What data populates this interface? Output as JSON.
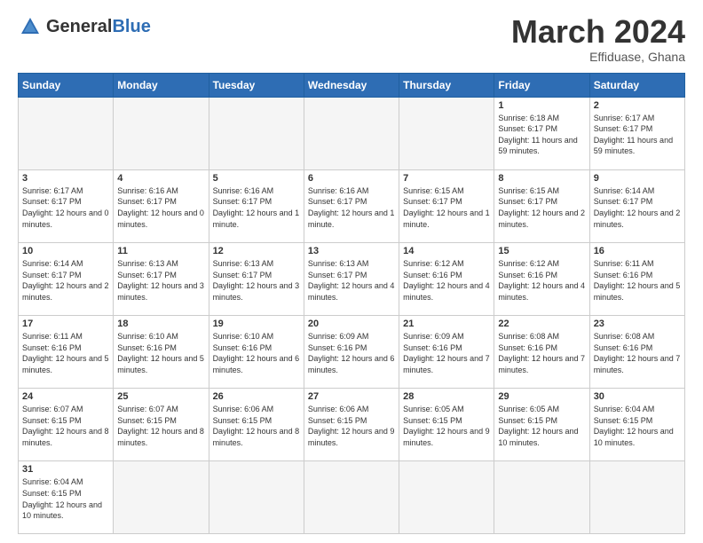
{
  "header": {
    "logo_general": "General",
    "logo_blue": "Blue",
    "title": "March 2024",
    "subtitle": "Effiduase, Ghana"
  },
  "weekdays": [
    "Sunday",
    "Monday",
    "Tuesday",
    "Wednesday",
    "Thursday",
    "Friday",
    "Saturday"
  ],
  "weeks": [
    [
      {
        "day": "",
        "info": "",
        "empty": true
      },
      {
        "day": "",
        "info": "",
        "empty": true
      },
      {
        "day": "",
        "info": "",
        "empty": true
      },
      {
        "day": "",
        "info": "",
        "empty": true
      },
      {
        "day": "",
        "info": "",
        "empty": true
      },
      {
        "day": "1",
        "info": "Sunrise: 6:18 AM\nSunset: 6:17 PM\nDaylight: 11 hours\nand 59 minutes."
      },
      {
        "day": "2",
        "info": "Sunrise: 6:17 AM\nSunset: 6:17 PM\nDaylight: 11 hours\nand 59 minutes."
      }
    ],
    [
      {
        "day": "3",
        "info": "Sunrise: 6:17 AM\nSunset: 6:17 PM\nDaylight: 12 hours\nand 0 minutes."
      },
      {
        "day": "4",
        "info": "Sunrise: 6:16 AM\nSunset: 6:17 PM\nDaylight: 12 hours\nand 0 minutes."
      },
      {
        "day": "5",
        "info": "Sunrise: 6:16 AM\nSunset: 6:17 PM\nDaylight: 12 hours\nand 1 minute."
      },
      {
        "day": "6",
        "info": "Sunrise: 6:16 AM\nSunset: 6:17 PM\nDaylight: 12 hours\nand 1 minute."
      },
      {
        "day": "7",
        "info": "Sunrise: 6:15 AM\nSunset: 6:17 PM\nDaylight: 12 hours\nand 1 minute."
      },
      {
        "day": "8",
        "info": "Sunrise: 6:15 AM\nSunset: 6:17 PM\nDaylight: 12 hours\nand 2 minutes."
      },
      {
        "day": "9",
        "info": "Sunrise: 6:14 AM\nSunset: 6:17 PM\nDaylight: 12 hours\nand 2 minutes."
      }
    ],
    [
      {
        "day": "10",
        "info": "Sunrise: 6:14 AM\nSunset: 6:17 PM\nDaylight: 12 hours\nand 2 minutes."
      },
      {
        "day": "11",
        "info": "Sunrise: 6:13 AM\nSunset: 6:17 PM\nDaylight: 12 hours\nand 3 minutes."
      },
      {
        "day": "12",
        "info": "Sunrise: 6:13 AM\nSunset: 6:17 PM\nDaylight: 12 hours\nand 3 minutes."
      },
      {
        "day": "13",
        "info": "Sunrise: 6:13 AM\nSunset: 6:17 PM\nDaylight: 12 hours\nand 4 minutes."
      },
      {
        "day": "14",
        "info": "Sunrise: 6:12 AM\nSunset: 6:16 PM\nDaylight: 12 hours\nand 4 minutes."
      },
      {
        "day": "15",
        "info": "Sunrise: 6:12 AM\nSunset: 6:16 PM\nDaylight: 12 hours\nand 4 minutes."
      },
      {
        "day": "16",
        "info": "Sunrise: 6:11 AM\nSunset: 6:16 PM\nDaylight: 12 hours\nand 5 minutes."
      }
    ],
    [
      {
        "day": "17",
        "info": "Sunrise: 6:11 AM\nSunset: 6:16 PM\nDaylight: 12 hours\nand 5 minutes."
      },
      {
        "day": "18",
        "info": "Sunrise: 6:10 AM\nSunset: 6:16 PM\nDaylight: 12 hours\nand 5 minutes."
      },
      {
        "day": "19",
        "info": "Sunrise: 6:10 AM\nSunset: 6:16 PM\nDaylight: 12 hours\nand 6 minutes."
      },
      {
        "day": "20",
        "info": "Sunrise: 6:09 AM\nSunset: 6:16 PM\nDaylight: 12 hours\nand 6 minutes."
      },
      {
        "day": "21",
        "info": "Sunrise: 6:09 AM\nSunset: 6:16 PM\nDaylight: 12 hours\nand 7 minutes."
      },
      {
        "day": "22",
        "info": "Sunrise: 6:08 AM\nSunset: 6:16 PM\nDaylight: 12 hours\nand 7 minutes."
      },
      {
        "day": "23",
        "info": "Sunrise: 6:08 AM\nSunset: 6:16 PM\nDaylight: 12 hours\nand 7 minutes."
      }
    ],
    [
      {
        "day": "24",
        "info": "Sunrise: 6:07 AM\nSunset: 6:15 PM\nDaylight: 12 hours\nand 8 minutes."
      },
      {
        "day": "25",
        "info": "Sunrise: 6:07 AM\nSunset: 6:15 PM\nDaylight: 12 hours\nand 8 minutes."
      },
      {
        "day": "26",
        "info": "Sunrise: 6:06 AM\nSunset: 6:15 PM\nDaylight: 12 hours\nand 8 minutes."
      },
      {
        "day": "27",
        "info": "Sunrise: 6:06 AM\nSunset: 6:15 PM\nDaylight: 12 hours\nand 9 minutes."
      },
      {
        "day": "28",
        "info": "Sunrise: 6:05 AM\nSunset: 6:15 PM\nDaylight: 12 hours\nand 9 minutes."
      },
      {
        "day": "29",
        "info": "Sunrise: 6:05 AM\nSunset: 6:15 PM\nDaylight: 12 hours\nand 10 minutes."
      },
      {
        "day": "30",
        "info": "Sunrise: 6:04 AM\nSunset: 6:15 PM\nDaylight: 12 hours\nand 10 minutes."
      }
    ],
    [
      {
        "day": "31",
        "info": "Sunrise: 6:04 AM\nSunset: 6:15 PM\nDaylight: 12 hours\nand 10 minutes.",
        "last": true
      },
      {
        "day": "",
        "info": "",
        "empty": true,
        "last": true
      },
      {
        "day": "",
        "info": "",
        "empty": true,
        "last": true
      },
      {
        "day": "",
        "info": "",
        "empty": true,
        "last": true
      },
      {
        "day": "",
        "info": "",
        "empty": true,
        "last": true
      },
      {
        "day": "",
        "info": "",
        "empty": true,
        "last": true
      },
      {
        "day": "",
        "info": "",
        "empty": true,
        "last": true
      }
    ]
  ]
}
